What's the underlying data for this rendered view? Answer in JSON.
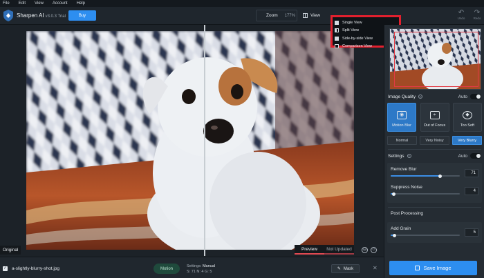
{
  "menu": [
    "File",
    "Edit",
    "View",
    "Account",
    "Help"
  ],
  "header": {
    "app_name": "Sharpen AI",
    "version": "v3.0.3 Trial",
    "buy_label": "Buy",
    "zoom_label": "Zoom",
    "zoom_value": "177%",
    "view_label": "View",
    "undo_label": "Undo",
    "redo_label": "Redo"
  },
  "view_menu": {
    "items": [
      "Single View",
      "Split View",
      "Side-by-side View",
      "Comparison View"
    ],
    "highlight_color": "#e3202e"
  },
  "canvas": {
    "original_label": "Original",
    "preview_tab": "Preview",
    "not_updated_tab": "Not Updated"
  },
  "panel": {
    "image_quality": {
      "title": "Image Quality",
      "auto_label": "Auto",
      "models": [
        "Motion Blur",
        "Out of Focus",
        "Too Soft"
      ],
      "selected_model": "Motion Blur",
      "blur_levels": [
        "Normal",
        "Very Noisy",
        "Very Blurry"
      ],
      "selected_blur": "Very Blurry"
    },
    "settings": {
      "title": "Settings",
      "auto_label": "Auto",
      "remove_blur_label": "Remove Blur",
      "remove_blur_value": "71",
      "remove_blur_fraction": 0.71,
      "suppress_noise_label": "Suppress Noise",
      "suppress_noise_value": "4",
      "suppress_noise_fraction": 0.04
    },
    "post_processing": {
      "title": "Post Processing",
      "add_grain_label": "Add Grain",
      "add_grain_value": "5",
      "add_grain_fraction": 0.05
    },
    "save_label": "Save Image"
  },
  "bottom": {
    "filename": "a-slightly-blurry-shot.jpg",
    "mode_badge": "Motion",
    "settings_label": "Settings:",
    "settings_value": "Manual",
    "settings_detail": "S: 71  N: 4  G: 5",
    "mask_label": "Mask"
  },
  "colors": {
    "accent": "#2d8ef0",
    "active_card": "#2d79c7",
    "preview_underline": "#e44a53",
    "badge_bg": "#1f4a3c"
  }
}
